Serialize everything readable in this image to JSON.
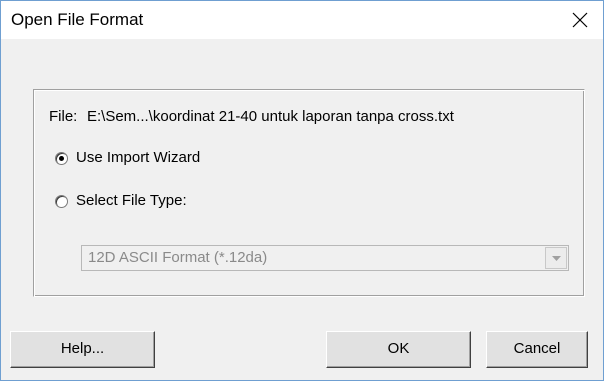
{
  "window": {
    "title": "Open File Format"
  },
  "file": {
    "label": "File:",
    "path": "E:\\Sem...\\koordinat 21-40 untuk laporan tanpa cross.txt"
  },
  "options": {
    "import_wizard_label": "Use Import Wizard",
    "import_wizard_selected": true,
    "select_type_label": "Select File Type:",
    "select_type_selected": false
  },
  "file_type_select": {
    "value": "12D ASCII Format (*.12da)",
    "enabled": false
  },
  "buttons": {
    "help": "Help...",
    "ok": "OK",
    "cancel": "Cancel"
  },
  "icons": {
    "close": "close-icon",
    "dropdown": "chevron-down-icon"
  },
  "colors": {
    "window_border": "#6f9fd1",
    "dialog_background": "#f0f0f0",
    "disabled_text": "#8a8a8a"
  }
}
